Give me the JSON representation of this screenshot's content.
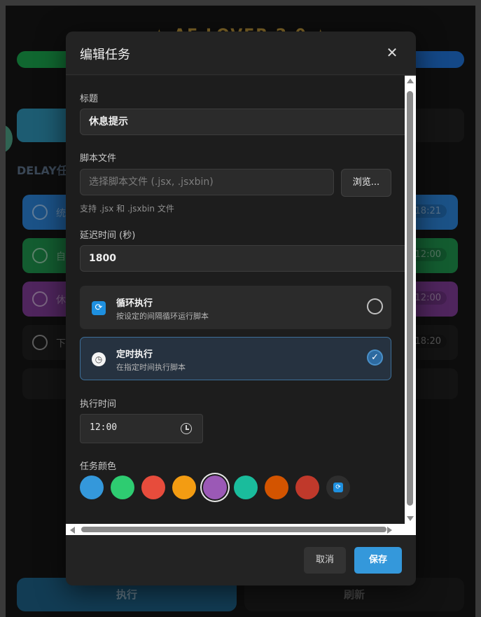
{
  "background": {
    "section_label": "DELAY任",
    "tasks": [
      {
        "label": "统",
        "time": "18:21",
        "color": "#2a7fd0"
      },
      {
        "label": "自",
        "time": "12:00",
        "color": "#1e8e4a"
      },
      {
        "label": "休",
        "time": "12:00",
        "color": "#7a3a90"
      },
      {
        "label": "下",
        "time": "18:20",
        "color": "#1e1e1e"
      }
    ],
    "run_label": "执行",
    "refresh_label": "刷新"
  },
  "modal": {
    "title": "编辑任务",
    "close_glyph": "✕",
    "title_label": "标题",
    "title_value": "休息提示",
    "script_label": "脚本文件",
    "script_placeholder": "选择脚本文件 (.jsx, .jsxbin)",
    "browse_label": "浏览...",
    "script_hint": "支持 .jsx 和 .jsxbin 文件",
    "delay_label": "延迟时间 (秒)",
    "delay_value": "1800",
    "modes": [
      {
        "title": "循环执行",
        "desc": "按设定的间隔循环运行脚本",
        "icon": "loop-icon",
        "selected": false
      },
      {
        "title": "定时执行",
        "desc": "在指定时间执行脚本",
        "icon": "clock-icon",
        "selected": true
      }
    ],
    "exec_time_label": "执行时间",
    "exec_time_value": "12:00",
    "color_label": "任务颜色",
    "colors": [
      "#3498db",
      "#2ecc71",
      "#e74c3c",
      "#f39c12",
      "#9b59b6",
      "#1abc9c",
      "#d35400",
      "#c0392b"
    ],
    "selected_color": "#9b59b6",
    "cancel_label": "取消",
    "save_label": "保存"
  }
}
